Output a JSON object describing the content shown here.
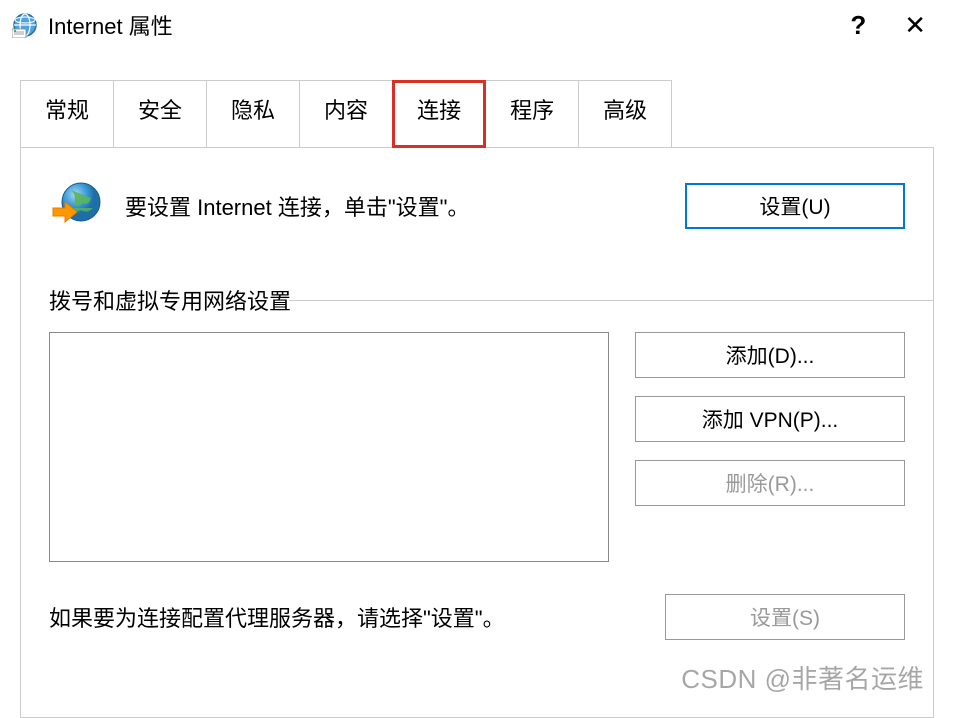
{
  "titlebar": {
    "title": "Internet 属性",
    "help": "?",
    "close": "✕"
  },
  "tabs": {
    "general": "常规",
    "security": "安全",
    "privacy": "隐私",
    "content": "内容",
    "connections": "连接",
    "programs": "程序",
    "advanced": "高级"
  },
  "setup": {
    "text": "要设置 Internet 连接，单击\"设置\"。",
    "button": "设置(U)"
  },
  "dialup": {
    "section_label": "拨号和虚拟专用网络设置",
    "add": "添加(D)...",
    "add_vpn": "添加 VPN(P)...",
    "remove": "删除(R)..."
  },
  "proxy": {
    "text": "如果要为连接配置代理服务器，请选择\"设置\"。",
    "button": "设置(S)"
  },
  "watermark": "CSDN @非著名运维"
}
